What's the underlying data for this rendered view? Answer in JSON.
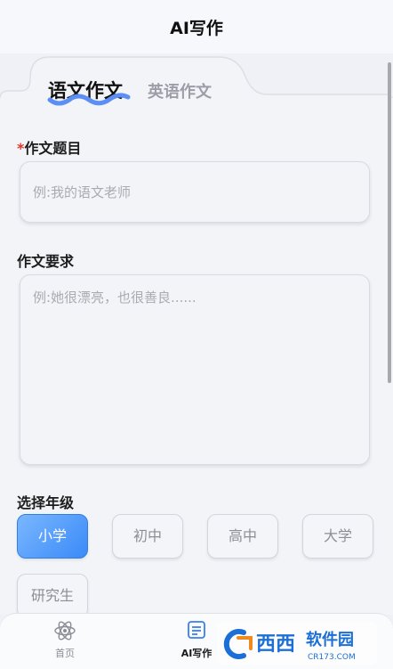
{
  "header": {
    "title": "AI写作"
  },
  "tabs": [
    {
      "label": "语文作文",
      "active": true
    },
    {
      "label": "英语作文",
      "active": false
    }
  ],
  "form": {
    "topic": {
      "required_mark": "*",
      "label": "作文题目",
      "placeholder": "例:我的语文老师",
      "value": ""
    },
    "requirements": {
      "label": "作文要求",
      "placeholder": "例:她很漂亮，也很善良......",
      "value": ""
    },
    "grade": {
      "label": "选择年级",
      "options": [
        "小学",
        "初中",
        "高中",
        "大学",
        "研究生"
      ],
      "selected": "小学"
    }
  },
  "bottom_nav": {
    "items": [
      {
        "label": "首页",
        "icon": "atom-icon",
        "active": false
      },
      {
        "label": "AI写作",
        "icon": "document-list-icon",
        "active": true
      }
    ]
  },
  "watermark": {
    "brand": "西西",
    "text": "软件园",
    "domain": "CR173.COM"
  },
  "colors": {
    "accent": "#3a8af8",
    "underline": "#5b8ff5",
    "required": "#e0342f"
  }
}
